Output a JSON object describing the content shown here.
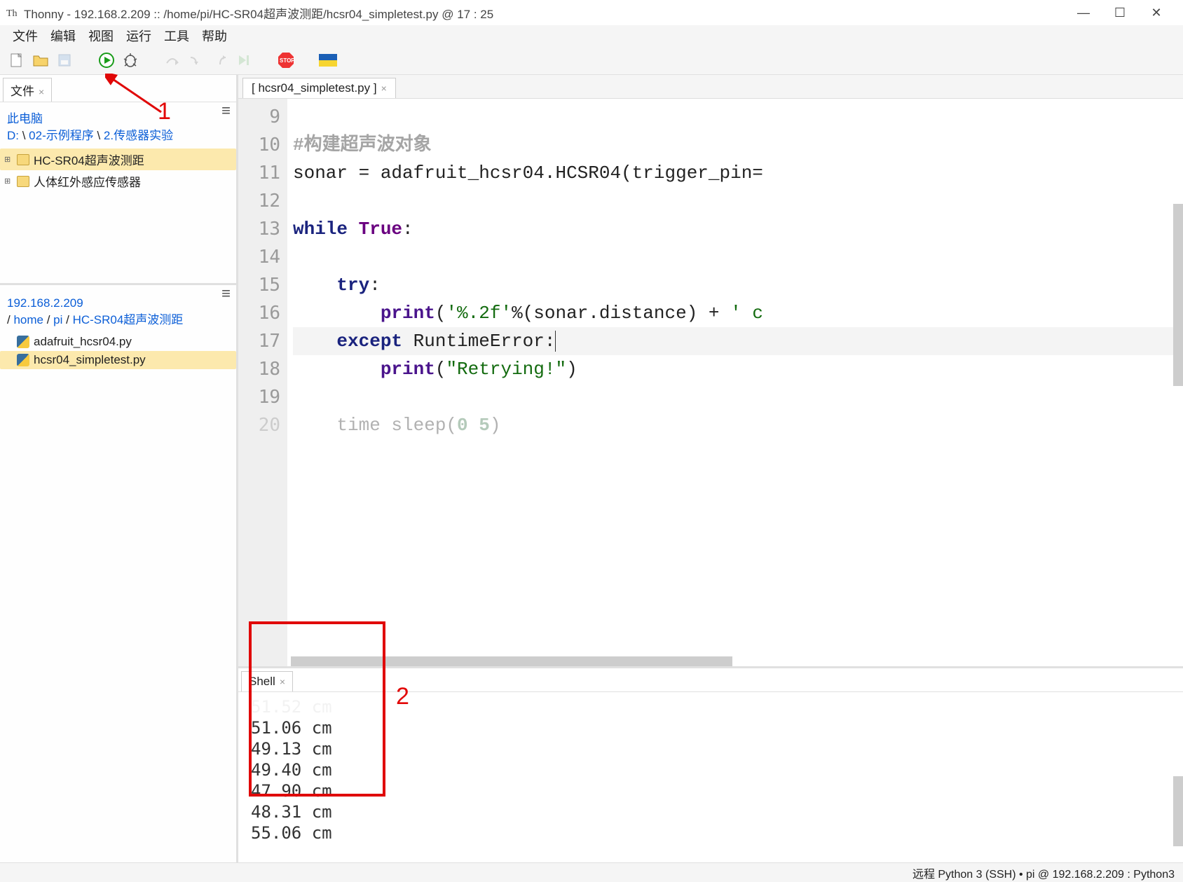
{
  "window": {
    "app_name": "Thonny",
    "title": "Thonny  -  192.168.2.209 :: /home/pi/HC-SR04超声波测距/hcsr04_simpletest.py  @  17 : 25"
  },
  "menubar": [
    "文件",
    "编辑",
    "视图",
    "运行",
    "工具",
    "帮助"
  ],
  "left": {
    "files_tab": "文件",
    "this_pc": "此电脑",
    "local_path_parts": [
      "D:",
      "02-示例程序",
      "2.传感器实验"
    ],
    "tree_local": [
      {
        "name": "HC-SR04超声波测距",
        "selected": true
      },
      {
        "name": "人体红外感应传感器",
        "selected": false
      }
    ],
    "remote_host": "192.168.2.209",
    "remote_path_parts": [
      "home",
      "pi",
      "HC-SR04超声波测距"
    ],
    "tree_remote": [
      {
        "name": "adafruit_hcsr04.py",
        "selected": false
      },
      {
        "name": "hcsr04_simpletest.py",
        "selected": true
      }
    ]
  },
  "editor": {
    "tab_label": "[ hcsr04_simpletest.py ]",
    "first_line_no": 9,
    "lines": [
      {
        "n": 9,
        "html": ""
      },
      {
        "n": 10,
        "html": "<span class='c-comment'>#构建超声波对象</span>"
      },
      {
        "n": 11,
        "html": "sonar = adafruit_hcsr04.HCSR04(trigger_pin="
      },
      {
        "n": 12,
        "html": ""
      },
      {
        "n": 13,
        "html": "<span class='c-kw'>while</span> <span class='c-bool'>True</span>:"
      },
      {
        "n": 14,
        "html": ""
      },
      {
        "n": 15,
        "html": "    <span class='c-kw'>try</span>:"
      },
      {
        "n": 16,
        "html": "        <span class='c-fn'>print</span>(<span class='c-str'>'%.2f'</span>%(sonar.distance) + <span class='c-str'>' c</span>"
      },
      {
        "n": 17,
        "html": "    <span class='c-kw'>except</span> RuntimeError:<span style='border-left:1px solid #333'></span>",
        "hl": true
      },
      {
        "n": 18,
        "html": "        <span class='c-fn'>print</span>(<span class='c-str'>\"Retrying!\"</span>)"
      },
      {
        "n": 19,
        "html": ""
      },
      {
        "n": 20,
        "html": "    time sleep(<span class='c-num'>0 5</span>)",
        "partial": true
      }
    ]
  },
  "shell": {
    "tab_label": "Shell",
    "top_partial": "51.52 cm",
    "output": [
      "51.06 cm",
      "49.13 cm",
      "49.40 cm",
      "47.90 cm",
      "48.31 cm",
      "55.06 cm"
    ]
  },
  "statusbar": "远程 Python 3 (SSH)  •  pi @ 192.168.2.209 : Python3",
  "annotations": {
    "label1": "1",
    "label2": "2"
  }
}
